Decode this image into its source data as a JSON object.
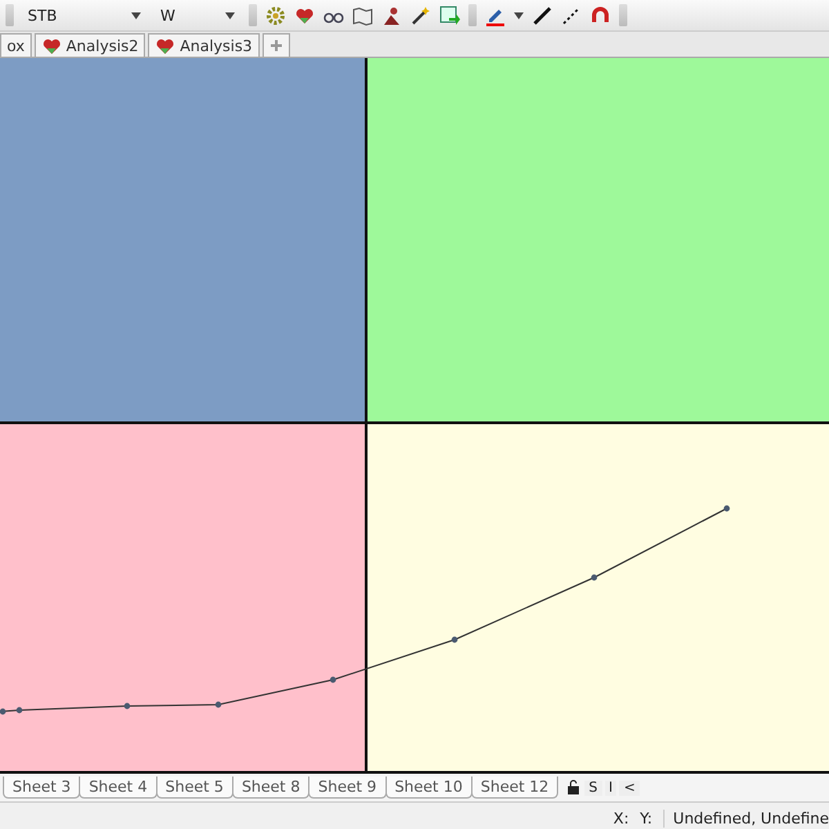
{
  "toolbar": {
    "symbol_combo": "STB",
    "period_combo": "W"
  },
  "tabs": [
    {
      "label": "ox"
    },
    {
      "label": "Analysis2"
    },
    {
      "label": "Analysis3"
    }
  ],
  "sheet_tabs": [
    "Sheet 3",
    "Sheet 4",
    "Sheet 5",
    "Sheet 8",
    "Sheet 9",
    "Sheet 10",
    "Sheet 12"
  ],
  "sheet_buttons": [
    "S",
    "I",
    "<"
  ],
  "status_bar": {
    "x_label": "X:",
    "y_label": "Y:",
    "value": "Undefined, Undefine"
  }
}
